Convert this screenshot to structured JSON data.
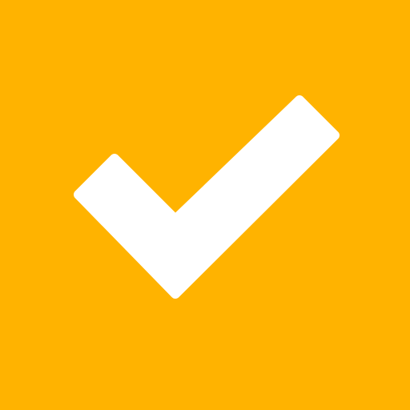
{
  "icon": {
    "name": "checkmark-icon",
    "background_color": "#FFB300",
    "glyph_color": "#FFFFFF"
  }
}
